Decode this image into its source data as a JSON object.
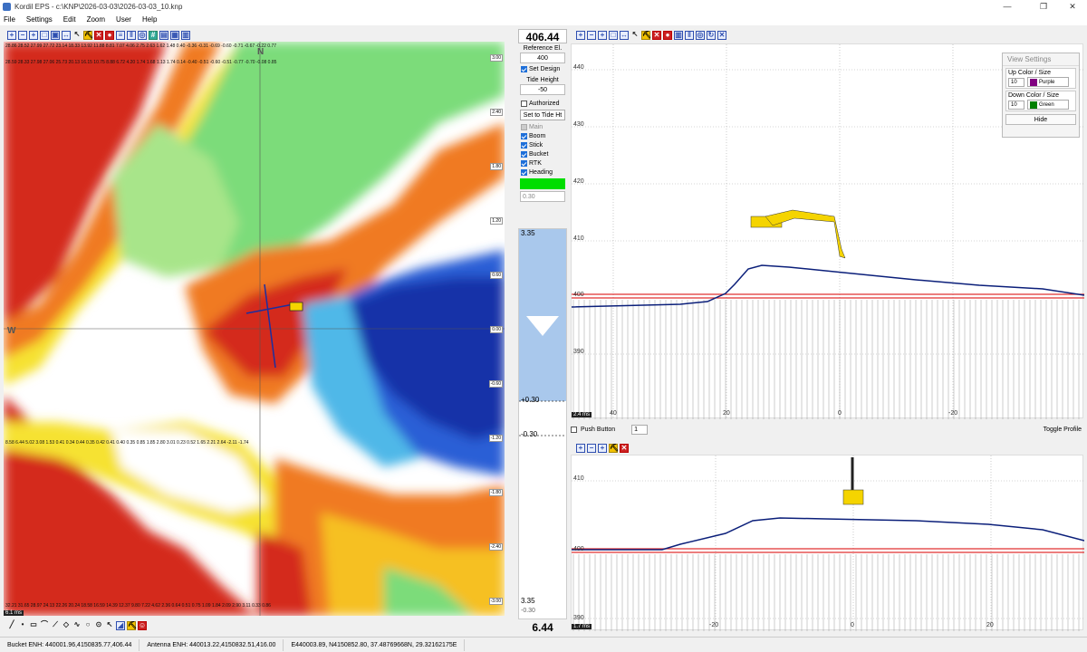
{
  "window": {
    "title": "Kordil EPS - c:\\KNP\\2026-03-03\\2026-03-03_10.knp",
    "minimize": "—",
    "maximize": "❐",
    "close": "✕"
  },
  "menu": [
    "File",
    "Settings",
    "Edit",
    "Zoom",
    "User",
    "Help"
  ],
  "grid": {
    "compass": {
      "n": "N",
      "w": "W"
    },
    "scale_marks": [
      "3.00",
      "2.40",
      "1.80",
      "1.20",
      "0.60",
      "0.00",
      "-0.60",
      "-1.20",
      "-1.80",
      "-2.40",
      "-3.00"
    ],
    "sample_cells": [
      [
        "28.86",
        "28.52",
        "27.99",
        "27.72",
        "23.14",
        "18.33",
        "13.92",
        "11.88",
        "8.81",
        "7.07",
        "4.06",
        "2.75",
        "2.63",
        "1.62",
        "1.48",
        "0.40",
        "-0.36",
        "-0.31",
        "-0.69",
        "-0.60",
        "-0.71",
        "-0.67",
        "-0.22",
        "0.77"
      ],
      [
        "28.59",
        "28.33",
        "27.98",
        "27.06",
        "25.73",
        "20.13",
        "16.15",
        "10.75",
        "8.88",
        "6.72",
        "4.20",
        "1.74",
        "1.68",
        "1.13",
        "1.74",
        "0.14",
        "-0.40",
        "-0.51",
        "-0.60",
        "-0.51",
        "-0.77",
        "-0.70",
        "-0.08",
        "0.85"
      ],
      [
        "8.58",
        "6.44",
        "5.02",
        "3.08",
        "1.53",
        "0.41",
        "0.34",
        "0.44",
        "0.35",
        "0.42",
        "0.41",
        "0.40",
        "0.35",
        "0.85",
        "1.85",
        "2.80",
        "3.01",
        "0.23",
        "0.52",
        "1.65",
        "2.21",
        "2.64",
        "-2.11",
        "-1.74"
      ],
      [
        "32.21",
        "31.65",
        "28.97",
        "24.13",
        "22.26",
        "20.24",
        "18.58",
        "16.59",
        "14.39",
        "12.37",
        "9.80",
        "7.22",
        "4.62",
        "2.36",
        "0.64",
        "0.51",
        "0.75",
        "1.09",
        "1.84",
        "2.09",
        "2.90",
        "3.11",
        "0.33",
        "0.86"
      ]
    ],
    "time": "6.1 ms"
  },
  "left_toolbar_bottom": [
    "line",
    "dot",
    "rect",
    "poly",
    "path",
    "shape",
    "curve",
    "circle",
    "target",
    "cursor",
    "grade",
    "excavator",
    "person"
  ],
  "control": {
    "elevation": "406.44",
    "ref_label": "Reference El.",
    "ref_value": "400",
    "set_design": "Set Design",
    "tide_label": "Tide Height",
    "tide_value": "-50",
    "authorized": "Authorized",
    "set_tide": "Set to Tide Ht",
    "layers": [
      {
        "label": "Main",
        "checked": true,
        "enabled": false
      },
      {
        "label": "Boom",
        "checked": true,
        "enabled": true
      },
      {
        "label": "Stick",
        "checked": true,
        "enabled": true
      },
      {
        "label": "Bucket",
        "checked": true,
        "enabled": true
      },
      {
        "label": "RTK",
        "checked": true,
        "enabled": true
      },
      {
        "label": "Heading",
        "checked": true,
        "enabled": true
      }
    ],
    "tolerance": "0.30",
    "status_color": "#00dd00"
  },
  "gauge": {
    "top": "3.35",
    "plus": "+0.30",
    "minus": "-0.30",
    "bottom_val": "3.35",
    "bottom_tol": "-0.30",
    "depth": "6.44"
  },
  "profile1": {
    "y_ticks": [
      "440",
      "430",
      "420",
      "410",
      "400",
      "390"
    ],
    "x_ticks": [
      "40",
      "20",
      "0",
      "-20"
    ],
    "time": "2.4 ms"
  },
  "viewsettings": {
    "title": "View Settings",
    "up_label": "Up Color / Size",
    "up_size": "10",
    "up_color_name": "Purple",
    "up_color": "#800080",
    "down_label": "Down Color / Size",
    "down_size": "10",
    "down_color_name": "Green",
    "down_color": "#008000",
    "hide": "Hide"
  },
  "push": {
    "label": "Push Button",
    "value": "1",
    "toggle": "Toggle Profile"
  },
  "profile2": {
    "y_ticks": [
      "410",
      "400",
      "390"
    ],
    "x_ticks": [
      "-20",
      "0",
      "20"
    ],
    "time": "1.7 ms"
  },
  "status": {
    "bucket": "Bucket ENH: 440001.96,4150835.77,406.44",
    "antenna": "Antenna ENH: 440013.22,4150832.51,416.00",
    "coords": "E440003.89, N4150852.80, 37.48769668N, 29.32162175E"
  },
  "colors": {
    "accent": "#2f4fb0",
    "design_line": "#e03030",
    "profile_line": "#0b1f7a",
    "bucket": "#f5d400"
  }
}
